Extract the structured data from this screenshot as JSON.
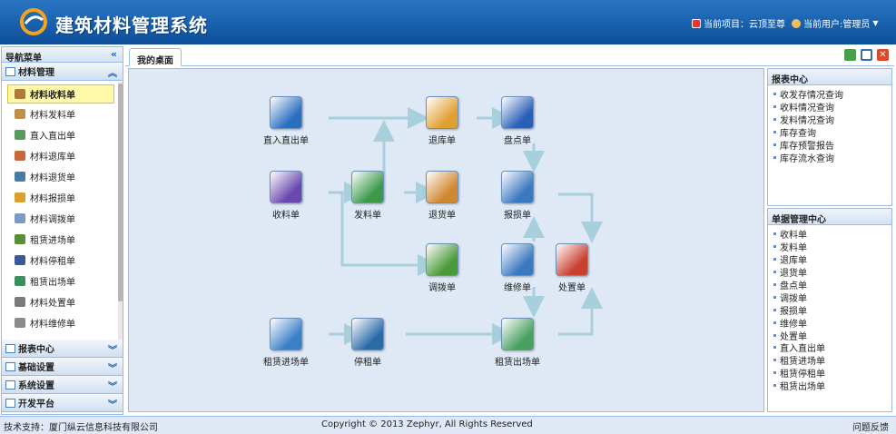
{
  "header": {
    "title": "建筑材料管理系统",
    "project_label": "当前项目：云顶至尊",
    "user_label": "当前用户:管理员"
  },
  "sidebar": {
    "title": "导航菜单",
    "section_open": "材料管理",
    "items": [
      {
        "label": "材料收料单",
        "icon": "warehouse-icon",
        "color": "#b07a3a",
        "selected": true
      },
      {
        "label": "材料发料单",
        "icon": "warehouse-icon",
        "color": "#c08f50"
      },
      {
        "label": "直入直出单",
        "icon": "document-icon",
        "color": "#5a9a5a"
      },
      {
        "label": "材料退库单",
        "icon": "truck-icon",
        "color": "#c76a3a"
      },
      {
        "label": "材料退货单",
        "icon": "return-icon",
        "color": "#4a7aa8"
      },
      {
        "label": "材料报损单",
        "icon": "folder-icon",
        "color": "#d9a030"
      },
      {
        "label": "材料调拨单",
        "icon": "transfer-icon",
        "color": "#7a9ac8"
      },
      {
        "label": "租赁进场单",
        "icon": "grid-icon",
        "color": "#5a8f3a"
      },
      {
        "label": "材料停租单",
        "icon": "pause-icon",
        "color": "#3a5a9a"
      },
      {
        "label": "租赁出场单",
        "icon": "grid-icon",
        "color": "#3a8f5a"
      },
      {
        "label": "材料处置单",
        "icon": "calculator-icon",
        "color": "#7a7a7a"
      },
      {
        "label": "材料维修单",
        "icon": "wrench-icon",
        "color": "#8a8a8a"
      }
    ],
    "sections": [
      "报表中心",
      "基础设置",
      "系统设置",
      "开发平台"
    ]
  },
  "tab": {
    "label": "我的桌面"
  },
  "flow": {
    "nodes": [
      {
        "id": "direct",
        "label": "直入直出单",
        "color": "#2b6fc0"
      },
      {
        "id": "retstore",
        "label": "退库单",
        "color": "#e0a030"
      },
      {
        "id": "inventory",
        "label": "盘点单",
        "color": "#2a5fb8"
      },
      {
        "id": "receive",
        "label": "收料单",
        "color": "#6a48b0"
      },
      {
        "id": "issue",
        "label": "发料单",
        "color": "#3a9a4a"
      },
      {
        "id": "retgoods",
        "label": "退货单",
        "color": "#d08830"
      },
      {
        "id": "loss",
        "label": "报损单",
        "color": "#3a78c0"
      },
      {
        "id": "transfer",
        "label": "调拨单",
        "color": "#4a9a3a"
      },
      {
        "id": "repair",
        "label": "维修单",
        "color": "#3a78c0"
      },
      {
        "id": "dispose",
        "label": "处置单",
        "color": "#c84030"
      },
      {
        "id": "leasein",
        "label": "租赁进场单",
        "color": "#3a80c8"
      },
      {
        "id": "stoplease",
        "label": "停租单",
        "color": "#2a6aa8"
      },
      {
        "id": "leaseout",
        "label": "租赁出场单",
        "color": "#4aa060"
      }
    ]
  },
  "report_center": {
    "title": "报表中心",
    "items": [
      "收发存情况查询",
      "收料情况查询",
      "发料情况查询",
      "库存查询",
      "库存预警报告",
      "库存流水查询"
    ]
  },
  "doc_center": {
    "title": "单据管理中心",
    "items": [
      "收料单",
      "发料单",
      "退库单",
      "退货单",
      "盘点单",
      "调拨单",
      "报损单",
      "维修单",
      "处置单",
      "直入直出单",
      "租赁进场单",
      "租赁停租单",
      "租赁出场单"
    ]
  },
  "footer": {
    "support": "技术支持：厦门纵云信息科技有限公司",
    "copyright": "Copyright © 2013 Zephyr, All Rights Reserved",
    "feedback": "问题反馈"
  },
  "colors": {
    "header": "#1a62b0",
    "arrow": "#a8d0dc",
    "border": "#99bbe8"
  }
}
